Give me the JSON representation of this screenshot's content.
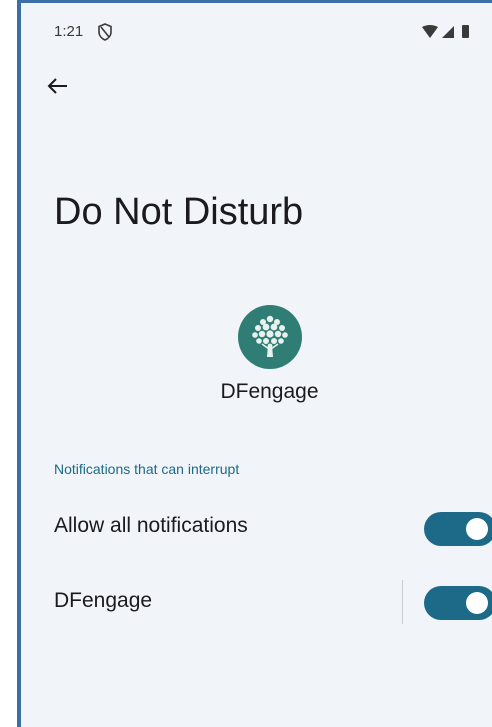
{
  "status_bar": {
    "time": "1:21",
    "shield_icon": "shield-icon",
    "wifi_icon": "wifi-icon",
    "signal_icon": "signal-icon",
    "battery_icon": "battery-icon"
  },
  "navigation": {
    "back_icon": "arrow-back-icon"
  },
  "page": {
    "title": "Do Not Disturb"
  },
  "app": {
    "icon": "tree-icon",
    "name": "DFengage"
  },
  "section": {
    "header": "Notifications that can interrupt"
  },
  "rows": [
    {
      "label": "Allow all notifications",
      "enabled": true
    },
    {
      "label": "DFengage",
      "enabled": true
    }
  ],
  "colors": {
    "accent": "#1c6a87",
    "background": "#f1f4f8",
    "app_icon_bg": "#2f7d74",
    "frame_border": "#3c6ea8"
  }
}
